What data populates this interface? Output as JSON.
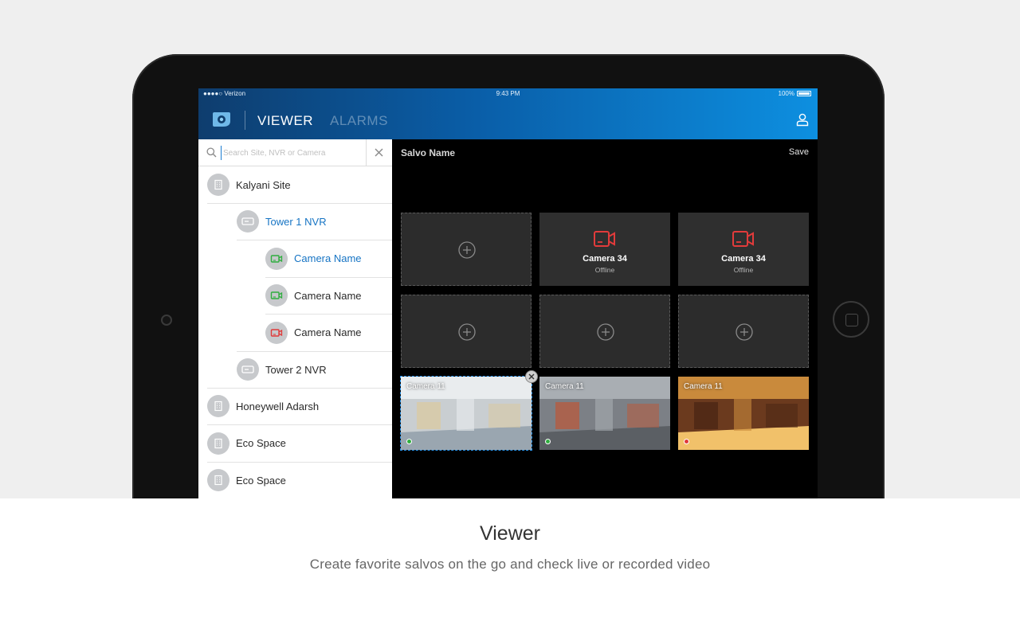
{
  "status_bar": {
    "carrier": "●●●●○ Verizon",
    "time": "9:43 PM",
    "battery": "100%"
  },
  "header": {
    "tabs": [
      {
        "label": "VIEWER",
        "active": true
      },
      {
        "label": "ALARMS",
        "active": false
      }
    ],
    "accent_color": "#0a7fd6"
  },
  "search": {
    "placeholder": "Search Site, NVR or Camera",
    "value": ""
  },
  "tree": [
    {
      "label": "Kalyani Site",
      "icon": "building-icon",
      "level": 0,
      "highlighted": false
    },
    {
      "label": "Tower 1 NVR",
      "icon": "nvr-icon",
      "level": 1,
      "highlighted": true
    },
    {
      "label": "Camera Name",
      "icon": "camera-online-icon",
      "level": 2,
      "highlighted": true,
      "status_color": "#2fae3f"
    },
    {
      "label": "Camera Name",
      "icon": "camera-online-icon",
      "level": 2,
      "highlighted": false,
      "status_color": "#2fae3f"
    },
    {
      "label": "Camera Name",
      "icon": "camera-offline-icon",
      "level": 2,
      "highlighted": false,
      "status_color": "#e03a3a"
    },
    {
      "label": "Tower 2 NVR",
      "icon": "nvr-icon",
      "level": 1,
      "highlighted": false
    },
    {
      "label": "Honeywell Adarsh",
      "icon": "building-icon",
      "level": 0,
      "highlighted": false
    },
    {
      "label": "Eco Space",
      "icon": "building-icon",
      "level": 0,
      "highlighted": false
    },
    {
      "label": "Eco Space",
      "icon": "building-icon",
      "level": 0,
      "highlighted": false
    }
  ],
  "salvo": {
    "title": "Salvo Name",
    "save_label": "Save",
    "tiles": [
      {
        "type": "empty"
      },
      {
        "type": "offline",
        "name": "Camera 34",
        "status": "Offline"
      },
      {
        "type": "offline",
        "name": "Camera 34",
        "status": "Offline"
      },
      {
        "type": "empty"
      },
      {
        "type": "empty"
      },
      {
        "type": "empty"
      },
      {
        "type": "live",
        "name": "Camera 11",
        "status_color": "#2fae3f",
        "selected": true
      },
      {
        "type": "live",
        "name": "Camera 11",
        "status_color": "#2fae3f",
        "selected": false
      },
      {
        "type": "live",
        "name": "Camera 11",
        "status_color": "#e03a3a",
        "selected": false
      }
    ]
  },
  "caption": {
    "title": "Viewer",
    "subtitle": "Create favorite salvos on the go and check live or recorded video"
  }
}
